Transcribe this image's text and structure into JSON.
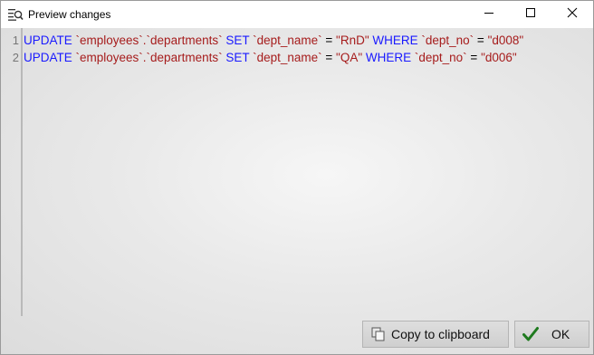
{
  "window": {
    "title": "Preview changes"
  },
  "controls": {
    "minimize_icon": "minimize-icon",
    "maximize_icon": "maximize-icon",
    "close_icon": "close-icon"
  },
  "editor": {
    "lines": [
      {
        "number": "1",
        "tokens": [
          {
            "type": "kw",
            "text": "UPDATE"
          },
          {
            "type": "id",
            "text": " `employees`.`departments`"
          },
          {
            "type": "kw",
            "text": " SET"
          },
          {
            "type": "id",
            "text": " `dept_name`"
          },
          {
            "type": "op",
            "text": " = "
          },
          {
            "type": "str",
            "text": "\"RnD\""
          },
          {
            "type": "kw",
            "text": " WHERE"
          },
          {
            "type": "id",
            "text": " `dept_no`"
          },
          {
            "type": "op",
            "text": " = "
          },
          {
            "type": "str",
            "text": "\"d008\""
          }
        ]
      },
      {
        "number": "2",
        "tokens": [
          {
            "type": "kw",
            "text": "UPDATE"
          },
          {
            "type": "id",
            "text": " `employees`.`departments`"
          },
          {
            "type": "kw",
            "text": " SET"
          },
          {
            "type": "id",
            "text": " `dept_name`"
          },
          {
            "type": "op",
            "text": " = "
          },
          {
            "type": "str",
            "text": "\"QA\""
          },
          {
            "type": "kw",
            "text": " WHERE"
          },
          {
            "type": "id",
            "text": " `dept_no`"
          },
          {
            "type": "op",
            "text": " = "
          },
          {
            "type": "str",
            "text": "\"d006\""
          }
        ]
      }
    ],
    "colors": {
      "keyword": "#1a1aff",
      "identifier": "#a61c1c",
      "string": "#a61c1c"
    }
  },
  "buttons": {
    "copy": {
      "label": "Copy to clipboard",
      "icon": "copy-icon"
    },
    "ok": {
      "label": "OK",
      "icon": "checkmark-icon",
      "icon_color": "#1e7a1e"
    }
  }
}
